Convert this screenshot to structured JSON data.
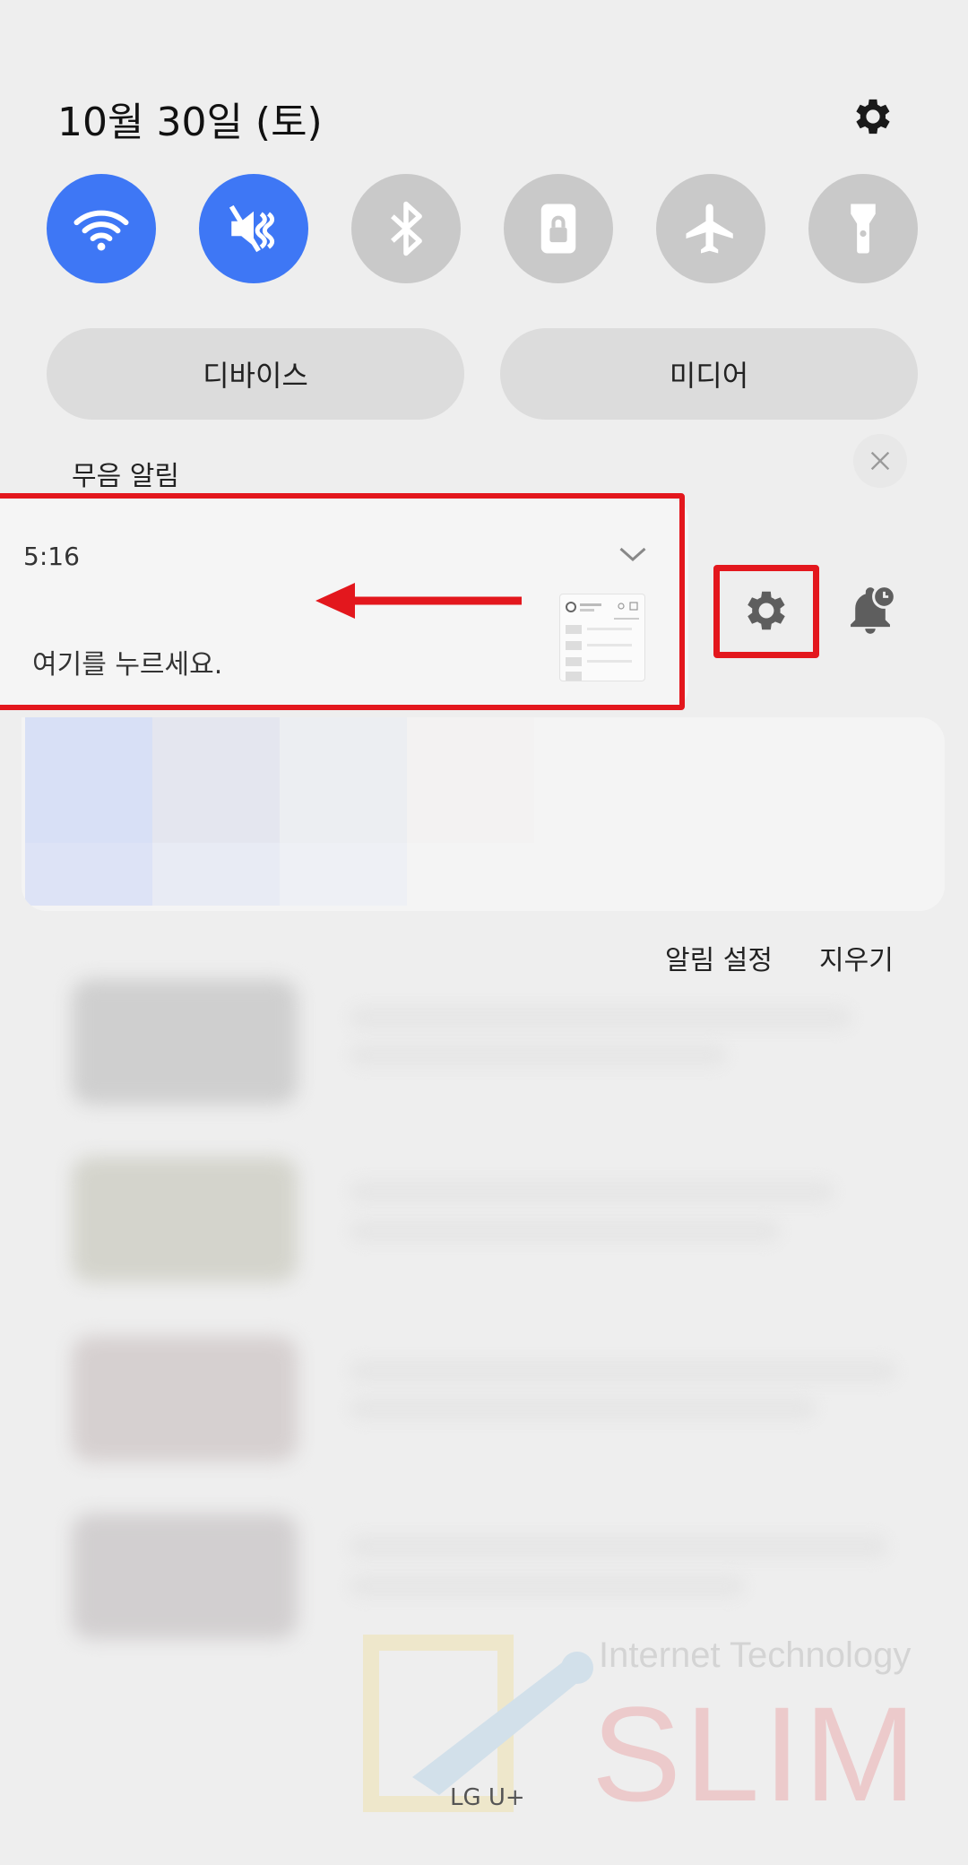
{
  "header": {
    "date": "10월 30일 (토)"
  },
  "quick_tiles": [
    {
      "name": "wifi",
      "icon": "wifi-icon",
      "active": true
    },
    {
      "name": "sound-mute",
      "icon": "mute-icon",
      "active": true
    },
    {
      "name": "bluetooth",
      "icon": "bluetooth-icon",
      "active": false
    },
    {
      "name": "rotation-lock",
      "icon": "lock-icon",
      "active": false
    },
    {
      "name": "airplane-mode",
      "icon": "airplane-icon",
      "active": false
    },
    {
      "name": "flashlight",
      "icon": "flashlight-icon",
      "active": false
    }
  ],
  "panels": {
    "devices": "디바이스",
    "media": "미디어"
  },
  "silent_section": {
    "label": "무음 알림"
  },
  "notification": {
    "time": "5:16",
    "message": "여기를 누르세요."
  },
  "actions": {
    "notification_settings": "알림 설정",
    "clear": "지우기"
  },
  "watermark": {
    "brand": "SLIM",
    "tagline": "Internet Technology"
  },
  "status": {
    "carrier": "LG U+"
  },
  "colors": {
    "accent": "#3e77f5",
    "highlight": "#e3171d",
    "tile_off": "#c9c9c9"
  }
}
